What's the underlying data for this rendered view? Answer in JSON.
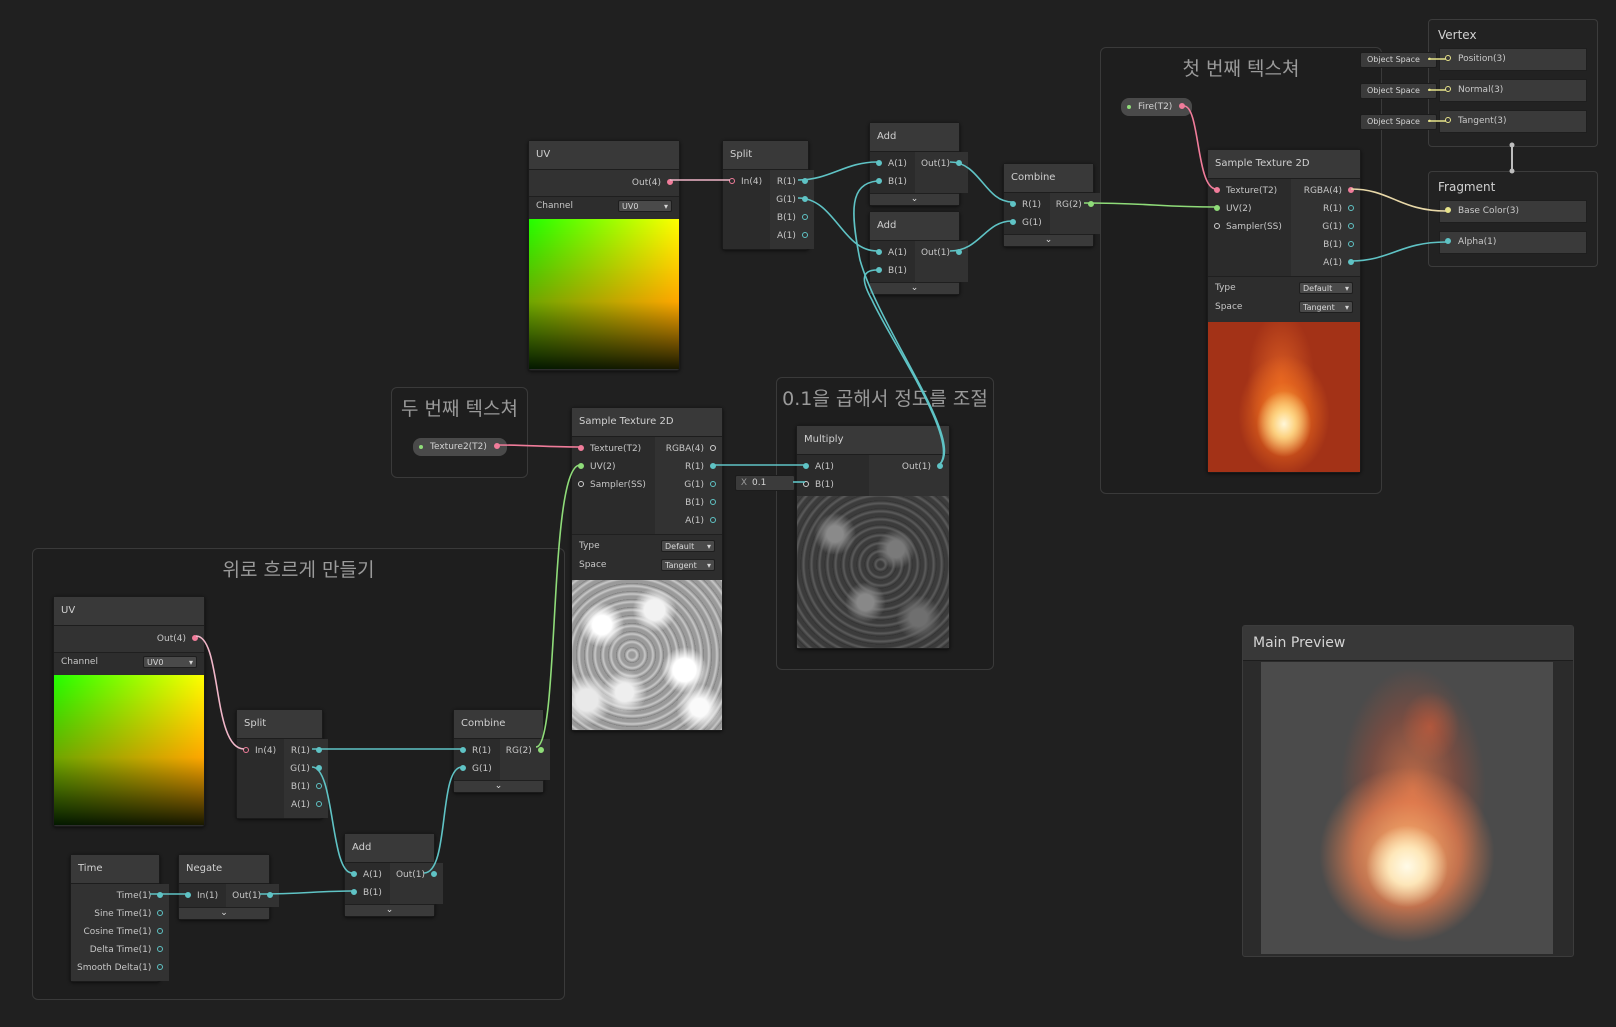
{
  "groups": {
    "first_texture": "첫 번째 텍스쳐",
    "second_texture": "두 번째 텍스쳐",
    "multiply_group": "0.1을 곱해서 정도를 조절",
    "flow_up": "위로 흐르게 만들기"
  },
  "uv_top": {
    "title": "UV",
    "out": "Out(4)",
    "channel_label": "Channel",
    "channel_value": "UV0"
  },
  "split_top": {
    "title": "Split",
    "in": "In(4)",
    "outs": [
      "R(1)",
      "G(1)",
      "B(1)",
      "A(1)"
    ]
  },
  "add_top1": {
    "title": "Add",
    "ins": [
      "A(1)",
      "B(1)"
    ],
    "out": "Out(1)"
  },
  "add_top2": {
    "title": "Add",
    "ins": [
      "A(1)",
      "B(1)"
    ],
    "out": "Out(1)"
  },
  "combine_top": {
    "title": "Combine",
    "ins": [
      "R(1)",
      "G(1)"
    ],
    "out": "RG(2)"
  },
  "sample_top": {
    "title": "Sample Texture 2D",
    "ins": [
      "Texture(T2)",
      "UV(2)",
      "Sampler(SS)"
    ],
    "outs": [
      "RGBA(4)",
      "R(1)",
      "G(1)",
      "B(1)",
      "A(1)"
    ],
    "type_label": "Type",
    "type_value": "Default",
    "space_label": "Space",
    "space_value": "Tangent"
  },
  "fire_property": "Fire(T2)",
  "texture2_property": "Texture2(T2)",
  "sample_mid": {
    "title": "Sample Texture 2D",
    "ins": [
      "Texture(T2)",
      "UV(2)",
      "Sampler(SS)"
    ],
    "outs": [
      "RGBA(4)",
      "R(1)",
      "G(1)",
      "B(1)",
      "A(1)"
    ],
    "type_label": "Type",
    "type_value": "Default",
    "space_label": "Space",
    "space_value": "Tangent"
  },
  "multiply": {
    "title": "Multiply",
    "ins": [
      "A(1)",
      "B(1)"
    ],
    "out": "Out(1)",
    "b_axis": "X",
    "b_value": "0.1"
  },
  "uv_bottom": {
    "title": "UV",
    "out": "Out(4)",
    "channel_label": "Channel",
    "channel_value": "UV0"
  },
  "split_bottom": {
    "title": "Split",
    "in": "In(4)",
    "outs": [
      "R(1)",
      "G(1)",
      "B(1)",
      "A(1)"
    ]
  },
  "combine_bottom": {
    "title": "Combine",
    "ins": [
      "R(1)",
      "G(1)"
    ],
    "out": "RG(2)"
  },
  "add_bottom": {
    "title": "Add",
    "ins": [
      "A(1)",
      "B(1)"
    ],
    "out": "Out(1)"
  },
  "time": {
    "title": "Time",
    "outs": [
      "Time(1)",
      "Sine Time(1)",
      "Cosine Time(1)",
      "Delta Time(1)",
      "Smooth Delta(1)"
    ]
  },
  "negate": {
    "title": "Negate",
    "in": "In(1)",
    "out": "Out(1)"
  },
  "vertex": {
    "title": "Vertex",
    "slots": [
      "Position(3)",
      "Normal(3)",
      "Tangent(3)"
    ],
    "space_tag": "Object Space"
  },
  "fragment": {
    "title": "Fragment",
    "slots": [
      "Base Color(3)",
      "Alpha(1)"
    ]
  },
  "main_preview": {
    "title": "Main Preview"
  },
  "colors": {
    "wire_float": "#5fc3c5",
    "wire_vec2": "#8fdc79",
    "wire_vec4": "#f0b6c8",
    "wire_texture": "#f07c9a",
    "background": "#202020"
  }
}
